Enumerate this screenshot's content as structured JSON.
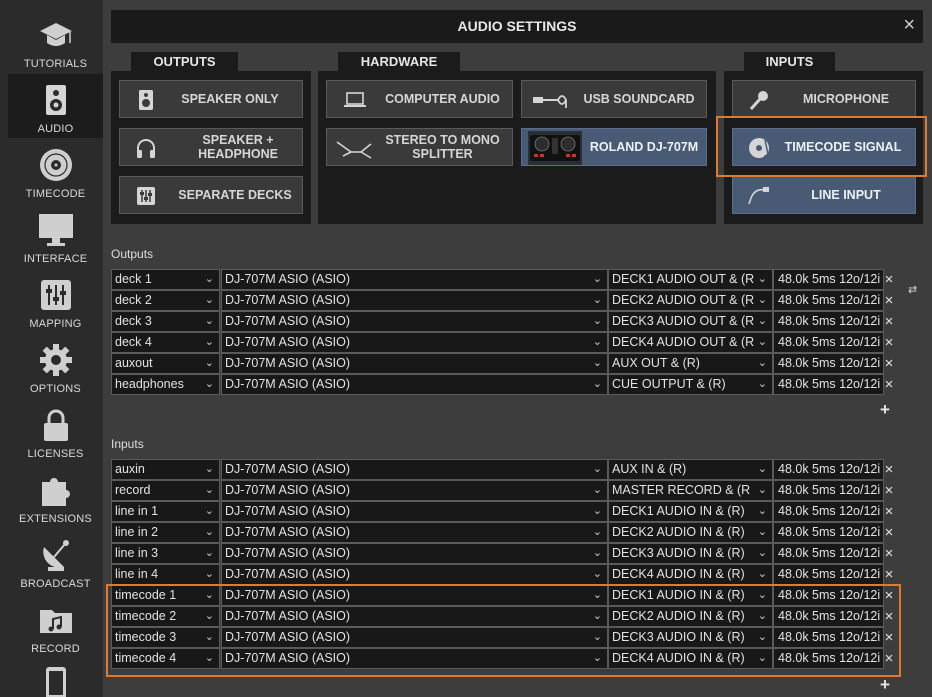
{
  "sidebar": {
    "items": [
      {
        "label": "TUTORIALS",
        "icon": "graduation-cap-icon"
      },
      {
        "label": "AUDIO",
        "icon": "speaker-icon",
        "active": true
      },
      {
        "label": "TIMECODE",
        "icon": "vinyl-icon"
      },
      {
        "label": "INTERFACE",
        "icon": "monitor-icon"
      },
      {
        "label": "MAPPING",
        "icon": "sliders-icon"
      },
      {
        "label": "OPTIONS",
        "icon": "gear-icon"
      },
      {
        "label": "LICENSES",
        "icon": "lock-icon"
      },
      {
        "label": "EXTENSIONS",
        "icon": "puzzle-icon"
      },
      {
        "label": "BROADCAST",
        "icon": "satellite-dish-icon"
      },
      {
        "label": "RECORD",
        "icon": "music-folder-icon"
      }
    ]
  },
  "title": "AUDIO SETTINGS",
  "close_glyph": "×",
  "outputs_panel": {
    "tab": "OUTPUTS",
    "buttons": [
      {
        "label": "SPEAKER ONLY",
        "icon": "speaker-icon"
      },
      {
        "label": "SPEAKER + HEADPHONE",
        "icon": "headphone-icon"
      },
      {
        "label": "SEPARATE DECKS",
        "icon": "mixer-icon"
      }
    ]
  },
  "hardware_panel": {
    "tab": "HARDWARE",
    "buttons": [
      {
        "label": "COMPUTER AUDIO",
        "icon": "laptop-icon"
      },
      {
        "label": "USB SOUNDCARD",
        "icon": "usb-cable-icon"
      },
      {
        "label": "STEREO TO MONO SPLITTER",
        "icon": "splitter-cable-icon"
      },
      {
        "label": "ROLAND DJ-707M",
        "icon": "controller-image",
        "selected": true
      }
    ]
  },
  "inputs_panel": {
    "tab": "INPUTS",
    "buttons": [
      {
        "label": "MICROPHONE",
        "icon": "microphone-icon"
      },
      {
        "label": "TIMECODE SIGNAL",
        "icon": "timecode-vinyl-icon",
        "selected": true
      },
      {
        "label": "LINE INPUT",
        "icon": "line-cable-icon",
        "selected": true
      }
    ]
  },
  "outputs_label": "Outputs",
  "inputs_label": "Inputs",
  "chevron": "⌄",
  "remove_glyph": "×",
  "add_glyph": "+",
  "swap_glyph": "⇄",
  "outputs": [
    {
      "channel": "deck 1",
      "device": "DJ-707M ASIO (ASIO)",
      "route": "DECK1 AUDIO OUT & (R",
      "format": "48.0k 5ms 12o/12i"
    },
    {
      "channel": "deck 2",
      "device": "DJ-707M ASIO (ASIO)",
      "route": "DECK2 AUDIO OUT & (R",
      "format": "48.0k 5ms 12o/12i"
    },
    {
      "channel": "deck 3",
      "device": "DJ-707M ASIO (ASIO)",
      "route": "DECK3 AUDIO OUT & (R",
      "format": "48.0k 5ms 12o/12i"
    },
    {
      "channel": "deck 4",
      "device": "DJ-707M ASIO (ASIO)",
      "route": "DECK4 AUDIO OUT & (R",
      "format": "48.0k 5ms 12o/12i"
    },
    {
      "channel": "auxout",
      "device": "DJ-707M ASIO (ASIO)",
      "route": "AUX OUT & (R)",
      "format": "48.0k 5ms 12o/12i"
    },
    {
      "channel": "headphones",
      "device": "DJ-707M ASIO (ASIO)",
      "route": "CUE OUTPUT & (R)",
      "format": "48.0k 5ms 12o/12i"
    }
  ],
  "inputs": [
    {
      "channel": "auxin",
      "device": "DJ-707M ASIO (ASIO)",
      "route": "AUX IN &  (R)",
      "format": "48.0k 5ms 12o/12i"
    },
    {
      "channel": "record",
      "device": "DJ-707M ASIO (ASIO)",
      "route": "MASTER RECORD & (R",
      "format": "48.0k 5ms 12o/12i"
    },
    {
      "channel": "line in 1",
      "device": "DJ-707M ASIO (ASIO)",
      "route": "DECK1 AUDIO IN & (R)",
      "format": "48.0k 5ms 12o/12i"
    },
    {
      "channel": "line in 2",
      "device": "DJ-707M ASIO (ASIO)",
      "route": "DECK2 AUDIO IN & (R)",
      "format": "48.0k 5ms 12o/12i"
    },
    {
      "channel": "line in 3",
      "device": "DJ-707M ASIO (ASIO)",
      "route": "DECK3 AUDIO IN & (R)",
      "format": "48.0k 5ms 12o/12i"
    },
    {
      "channel": "line in 4",
      "device": "DJ-707M ASIO (ASIO)",
      "route": "DECK4 AUDIO IN & (R)",
      "format": "48.0k 5ms 12o/12i"
    },
    {
      "channel": "timecode 1",
      "device": "DJ-707M ASIO (ASIO)",
      "route": "DECK1 AUDIO IN & (R)",
      "format": "48.0k 5ms 12o/12i"
    },
    {
      "channel": "timecode 2",
      "device": "DJ-707M ASIO (ASIO)",
      "route": "DECK2 AUDIO IN & (R)",
      "format": "48.0k 5ms 12o/12i"
    },
    {
      "channel": "timecode 3",
      "device": "DJ-707M ASIO (ASIO)",
      "route": "DECK3 AUDIO IN & (R)",
      "format": "48.0k 5ms 12o/12i"
    },
    {
      "channel": "timecode 4",
      "device": "DJ-707M ASIO (ASIO)",
      "route": "DECK4 AUDIO IN & (R)",
      "format": "48.0k 5ms 12o/12i"
    }
  ],
  "colors": {
    "accent_highlight": "#e07a2c",
    "selected_button": "#485a74",
    "background": "#3d3d3d",
    "sidebar": "#2b2b2b"
  }
}
